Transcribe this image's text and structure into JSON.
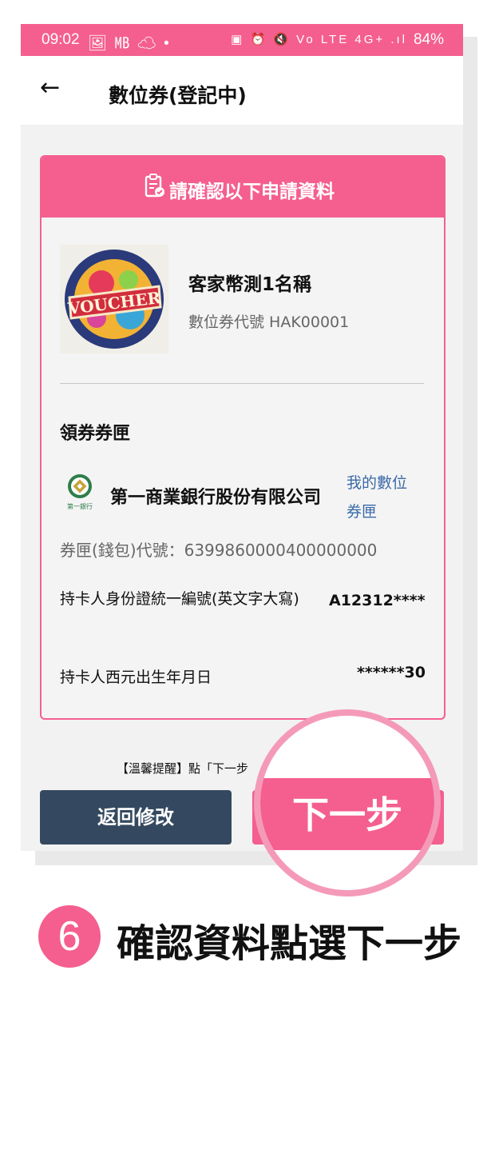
{
  "status_bar": {
    "time": "09:02",
    "left_icons": "🖼 ㎆ ☁ •",
    "right_icons": "▣ ⏰ 🔇 Vo LTE 4G+ .ıl",
    "battery": "84%"
  },
  "app_bar": {
    "back_icon": "←",
    "title": "數位券(登記中)"
  },
  "card": {
    "header": "請確認以下申請資料",
    "voucher_name": "客家幣測1名稱",
    "voucher_code": "數位券代號 HAK00001",
    "wallet_section_title": "領券券匣",
    "bank_logo_caption": "第一銀行",
    "bank_name": "第一商業銀行股份有限公司",
    "my_wallet_link": "我的數位券匣",
    "wallet_id": "券匣(錢包)代號：6399860000400000000",
    "holder_id_label": "持卡人身份證統一編號(英文字大寫)",
    "holder_id_value": "A12312****",
    "dob_label": "持卡人西元出生年月日",
    "dob_value": "******30"
  },
  "reminder": "【溫馨提醒】點「下一步",
  "buttons": {
    "back_edit": "返回修改",
    "next": "下一步"
  },
  "instruction": {
    "step_number": "6",
    "text": "確認資料點選下一步"
  },
  "colors": {
    "accent": "#f45f8f",
    "dark_button": "#34495f",
    "link": "#3a6aa8"
  }
}
